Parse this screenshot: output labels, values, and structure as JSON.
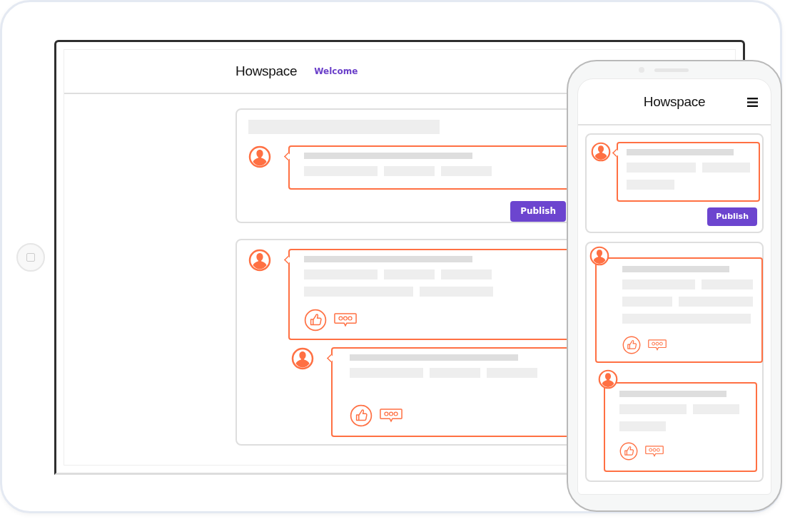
{
  "tablet": {
    "logo": "Howspace",
    "nav_link": "Welcome",
    "cards": [
      {
        "kind": "composer",
        "button": "Publish"
      },
      {
        "kind": "thread"
      }
    ]
  },
  "phone": {
    "logo": "Howspace",
    "cards": [
      {
        "kind": "composer",
        "button": "Publish"
      },
      {
        "kind": "thread"
      }
    ]
  }
}
